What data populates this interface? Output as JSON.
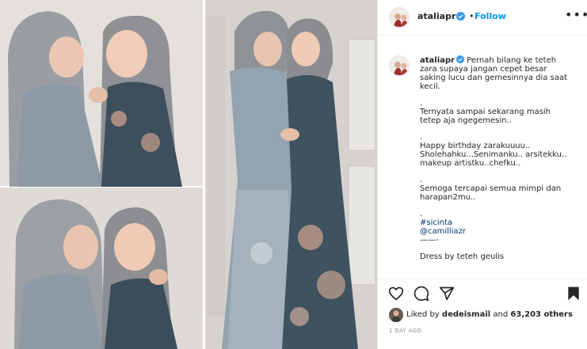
{
  "post": {
    "username": "ataliapr",
    "follow_separator": "•",
    "follow_label": "Follow",
    "more_label": "•••"
  },
  "caption": {
    "username": "ataliapr",
    "paragraphs": [
      [
        "Pernah bilang ke teteh",
        "zara supaya jangan cepet besar",
        "saking lucu dan gemesinnya dia saat",
        "kecil."
      ],
      [
        "."
      ],
      [
        "Ternyata sampai sekarang masih",
        "tetep aja ngegemesin.."
      ],
      [
        "."
      ],
      [
        "Happy birthday zarakuuuu..",
        "Sholehahku...Senimanku.. arsitekku..",
        "makeup artistku..chefku.."
      ],
      [
        "."
      ],
      [
        "Semoga tercapai semua mimpi dan",
        "harapan2mu.."
      ],
      [
        "."
      ]
    ],
    "hashtag": "#sicinta",
    "mention": "@camilliazr",
    "dashes": "——-",
    "credit": "Dress by teteh geulis"
  },
  "actions": {
    "like_icon": "heart-icon",
    "comment_icon": "comment-icon",
    "share_icon": "share-icon",
    "save_icon": "bookmark-icon"
  },
  "likes": {
    "prefix": "Liked by",
    "user": "dedeismail",
    "middle": "and",
    "count": "63,203 others"
  },
  "timestamp": "1 DAY AGO",
  "colors": {
    "accent": "#0095f6",
    "verified": "#3897f0",
    "link": "#00376b",
    "muted": "#8e8e8e",
    "border": "#efefef"
  }
}
